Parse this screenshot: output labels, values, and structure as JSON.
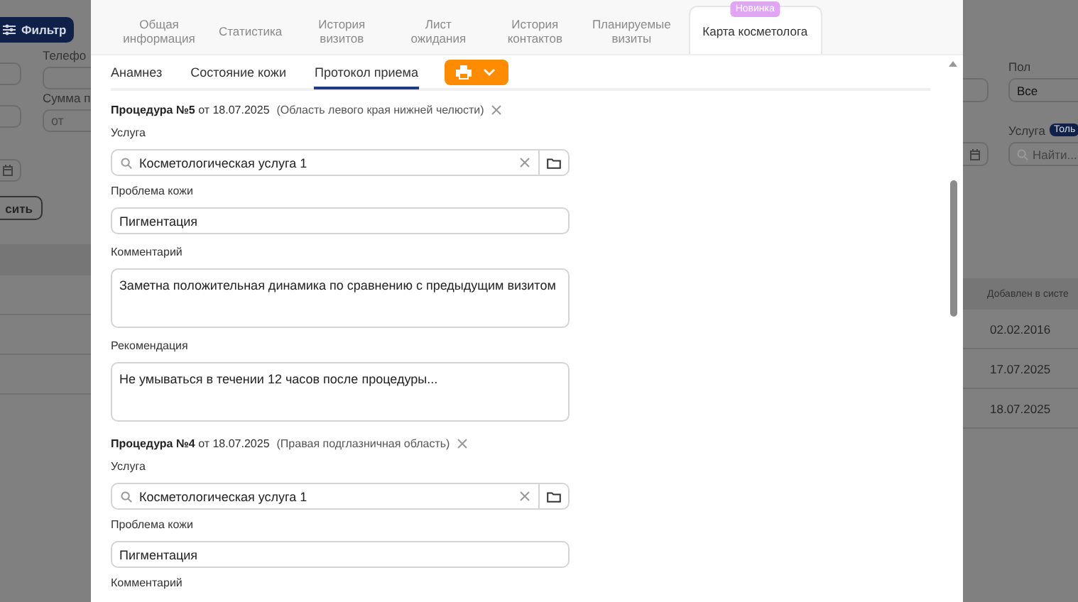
{
  "background": {
    "filter_button": "Фильтр",
    "left_filters": [
      {
        "label": "Телефо"
      },
      {
        "label": "Сумма п",
        "placeholder": "от"
      }
    ],
    "apply_button": "сить",
    "right_filters": [
      {
        "label": "Пол",
        "value": "Все"
      },
      {
        "label": "Услуга",
        "badge": "Толь",
        "placeholder": "Найти..."
      }
    ],
    "table": {
      "column": "Добавлен в систе",
      "cells": [
        "02.02.2016",
        "17.07.2025",
        "18.07.2025"
      ]
    }
  },
  "modal": {
    "tabs": [
      {
        "label": "Общая информация",
        "selected": false
      },
      {
        "label": "Статистика",
        "selected": false
      },
      {
        "label": "История визитов",
        "selected": false
      },
      {
        "label": "Лист ожидания",
        "selected": false
      },
      {
        "label": "История контактов",
        "selected": false
      },
      {
        "label": "Планируемые визиты",
        "selected": false
      },
      {
        "label": "Карта косметолога",
        "selected": true,
        "badge": "Новинка"
      }
    ],
    "subtabs": [
      {
        "label": "Анамнез",
        "selected": false
      },
      {
        "label": "Состояние кожи",
        "selected": false
      },
      {
        "label": "Протокол приема",
        "selected": true
      }
    ],
    "procedures": [
      {
        "title": "**Процедура №5** от 18.07.2025",
        "area": "(Область левого края нижней челюсти)",
        "fields": [
          {
            "kind": "search",
            "label": "Услуга",
            "value": "Косметологическая услуга 1"
          },
          {
            "kind": "text",
            "label": "Проблема кожи",
            "value": "Пигментация"
          },
          {
            "kind": "textarea",
            "label": "Комментарий",
            "value": "Заметна положительная динамика по сравнению с предыдущим визитом"
          },
          {
            "kind": "textarea",
            "label": "Рекомендация",
            "value": "Не умываться в течении 12 часов после процедуры..."
          }
        ]
      },
      {
        "title": "**Процедура №4** от 18.07.2025",
        "area": "(Правая подглазничная область)",
        "fields": [
          {
            "kind": "search",
            "label": "Услуга",
            "value": "Косметологическая услуга 1"
          },
          {
            "kind": "text",
            "label": "Проблема кожи",
            "value": "Пигментация"
          },
          {
            "kind": "label",
            "label": "Комментарий"
          }
        ]
      }
    ]
  }
}
